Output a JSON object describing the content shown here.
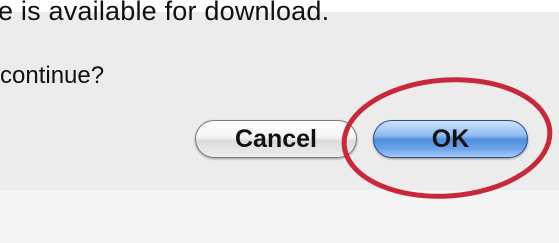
{
  "dialog": {
    "message_partial": "e is available for download.",
    "question_partial": "continue?",
    "buttons": {
      "cancel_label": "Cancel",
      "ok_label": "OK"
    }
  },
  "colors": {
    "highlight": "#c8283a",
    "ok_accent": "#4d8fdd"
  }
}
